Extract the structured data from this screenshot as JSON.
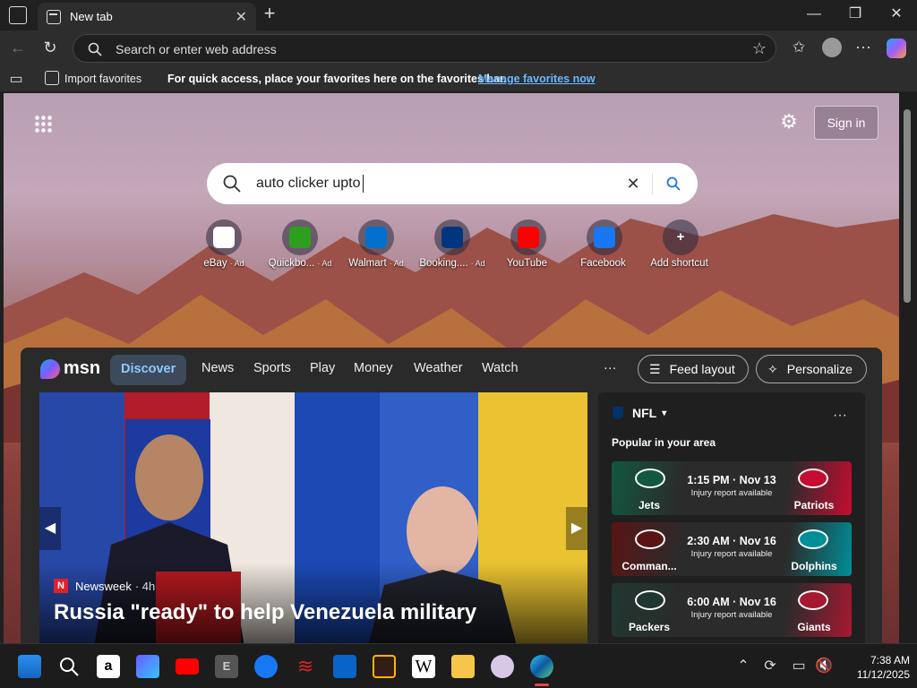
{
  "tab": {
    "title": "New tab"
  },
  "address": {
    "placeholder": "Search or enter web address"
  },
  "favbar": {
    "import": "Import favorites",
    "message": "For quick access, place your favorites here on the favorites bar.",
    "manage": "Manage favorites now"
  },
  "ntp": {
    "signin": "Sign in",
    "search_value": "auto clicker upto",
    "shortcuts": [
      {
        "label": "eBay",
        "ad": "· Ad",
        "color": "#ffffff"
      },
      {
        "label": "Quickbo...",
        "ad": "· Ad",
        "color": "#2ca01c"
      },
      {
        "label": "Walmart",
        "ad": "· Ad",
        "color": "#0071ce"
      },
      {
        "label": "Booking....",
        "ad": "· Ad",
        "color": "#003580"
      },
      {
        "label": "YouTube",
        "ad": "",
        "color": "#ff0000"
      },
      {
        "label": "Facebook",
        "ad": "",
        "color": "#1877f2"
      },
      {
        "label": "Add shortcut",
        "ad": "",
        "color": "#666666"
      }
    ]
  },
  "msn": {
    "logo": "msn",
    "tabs": [
      "Discover",
      "News",
      "Sports",
      "Play",
      "Money",
      "Weather",
      "Watch"
    ],
    "more": "···",
    "feed_layout": "Feed layout",
    "personalize": "Personalize",
    "hero": {
      "source": "Newsweek",
      "age": "· 4h",
      "headline": "Russia \"ready\" to help Venezuela military"
    },
    "nfl": {
      "title": "NFL",
      "subtitle": "Popular in your area",
      "games": [
        {
          "time": "1:15 PM · Nov 13",
          "note": "Injury report available",
          "home": "Jets",
          "away": "Patriots",
          "c1": "#125740",
          "c2": "#c60c30"
        },
        {
          "time": "2:30 AM · Nov 16",
          "note": "Injury report available",
          "home": "Comman...",
          "away": "Dolphins",
          "c1": "#5a1414",
          "c2": "#008e97"
        },
        {
          "time": "6:00 AM · Nov 16",
          "note": "Injury report available",
          "home": "Packers",
          "away": "Giants",
          "c1": "#203731",
          "c2": "#a71930"
        }
      ]
    }
  },
  "taskbar": {
    "time": "7:38 AM",
    "date": "11/12/2025"
  }
}
